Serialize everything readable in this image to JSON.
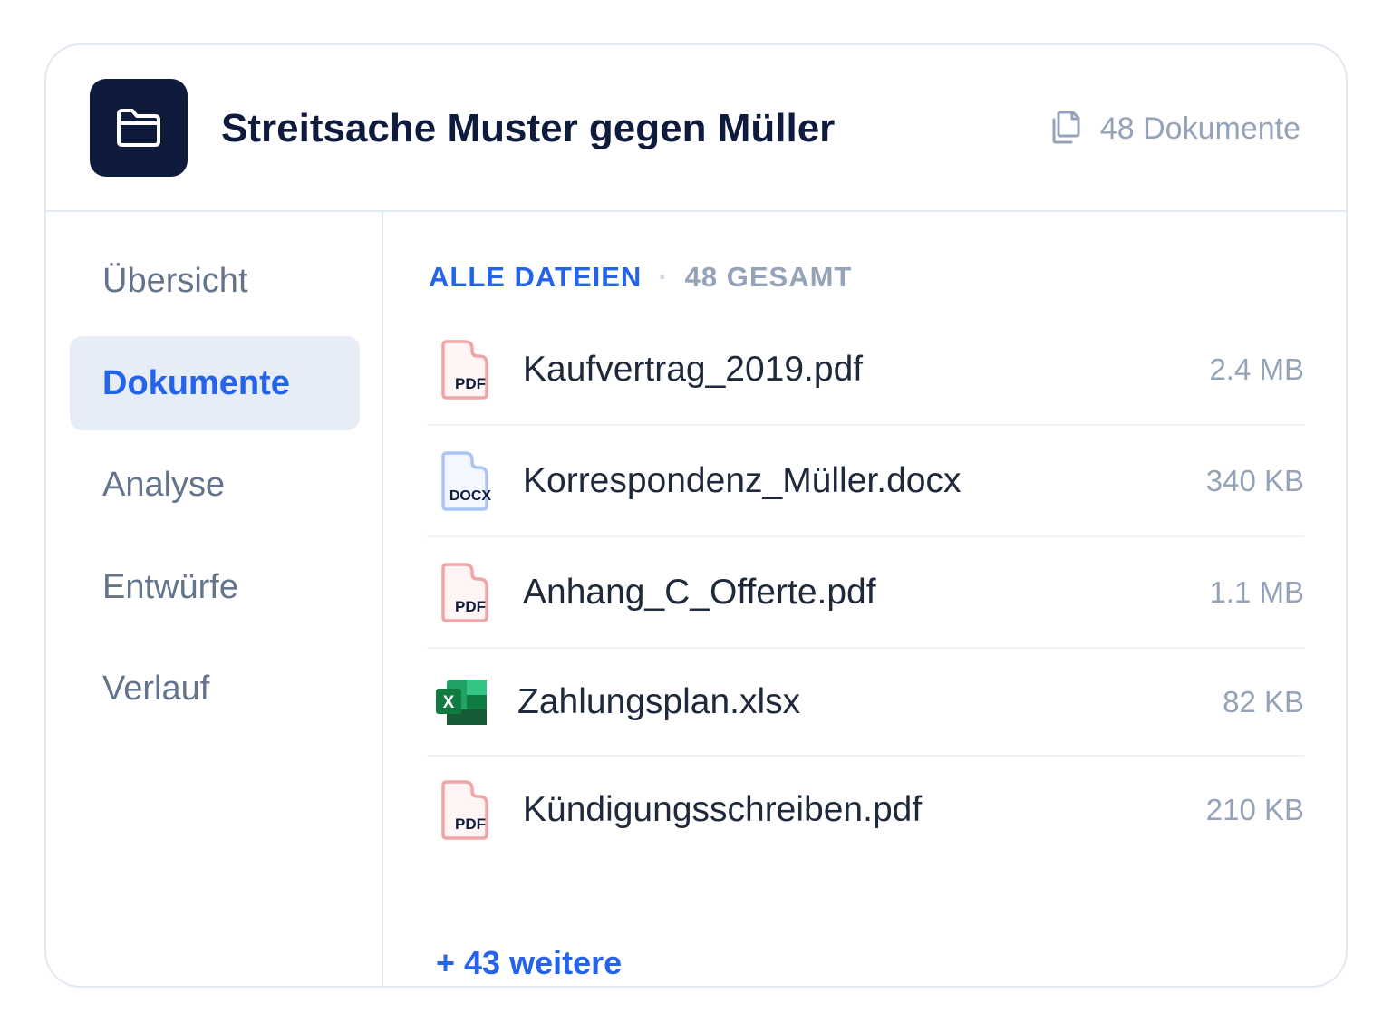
{
  "header": {
    "title": "Streitsache Muster gegen Müller",
    "doc_count": "48 Dokumente",
    "folder_icon": "folder-icon",
    "count_icon": "copy-icon"
  },
  "sidebar": {
    "items": [
      {
        "label": "Übersicht",
        "active": false
      },
      {
        "label": "Dokumente",
        "active": true
      },
      {
        "label": "Analyse",
        "active": false
      },
      {
        "label": "Entwürfe",
        "active": false
      },
      {
        "label": "Verlauf",
        "active": false
      }
    ]
  },
  "main": {
    "section_label": "ALLE DATEIEN",
    "separator": "·",
    "section_total": "48 GESAMT",
    "files": [
      {
        "name": "Kaufvertrag_2019.pdf",
        "size": "2.4 MB",
        "type_label": "PDF"
      },
      {
        "name": "Korrespondenz_Müller.docx",
        "size": "340 KB",
        "type_label": "DOCX"
      },
      {
        "name": "Anhang_C_Offerte.pdf",
        "size": "1.1 MB",
        "type_label": "PDF"
      },
      {
        "name": "Zahlungsplan.xlsx",
        "size": "82 KB",
        "type_label": "X"
      },
      {
        "name": "Kündigungsschreiben.pdf",
        "size": "210 KB",
        "type_label": "PDF"
      }
    ],
    "more_link": "+ 43 weitere"
  },
  "colors": {
    "accent": "#2563eb",
    "navy": "#0f1b3d",
    "muted": "#94a3b8",
    "pdf": "#f0a5a5",
    "docx": "#a9c4f5",
    "xlsx": "#21a366"
  }
}
